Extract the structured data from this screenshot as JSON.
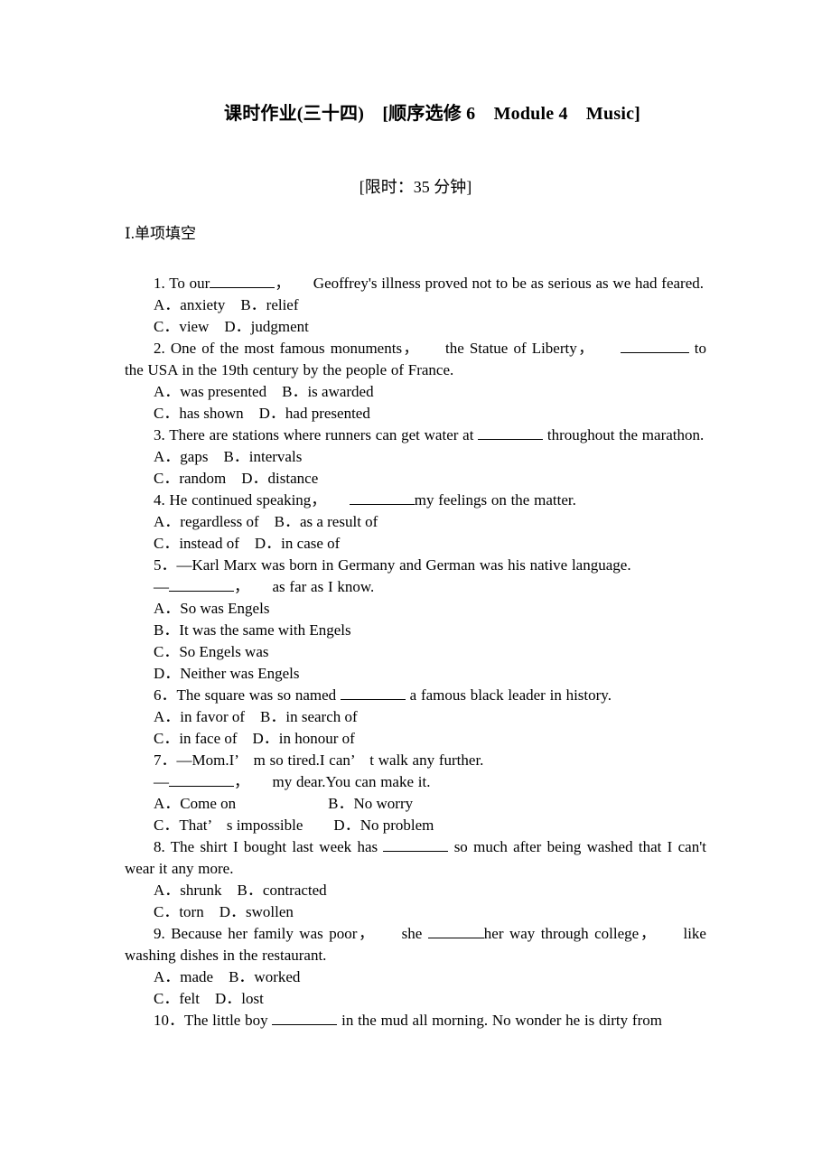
{
  "document": {
    "title": "课时作业(三十四)　[顺序选修 6　Module 4　Music]",
    "time_limit": "[限时：35 分钟]",
    "section_title": "Ⅰ.单项填空"
  },
  "questions": [
    {
      "number": "1",
      "stem_lines": [
        "1. To our",
        "，　　Geoffrey's illness proved not to be as serious as we had feared."
      ],
      "option_lines": [
        "A．anxiety　B．relief",
        "C．view　D．judgment"
      ]
    },
    {
      "number": "2",
      "stem_lines": [
        "2. One of the most famous monuments，　　the Statue of Liberty，　　",
        " to the USA in the 19th century by the people of France."
      ],
      "option_lines": [
        "A．was presented　B．is awarded",
        "C．has shown　D．had presented"
      ]
    },
    {
      "number": "3",
      "stem_lines": [
        "3. There are stations where runners can get water at ",
        " throughout the marathon."
      ],
      "option_lines": [
        "A．gaps　B．intervals",
        "C．random　D．distance"
      ]
    },
    {
      "number": "4",
      "stem_lines": [
        "4. He continued speaking，　　",
        "my feelings on the matter."
      ],
      "option_lines": [
        "A．regardless of　B．as a result of",
        "C．instead of　D．in case of"
      ]
    },
    {
      "number": "5",
      "stem_lines": [
        "5．—Karl Marx was born in Germany and German was his native language.",
        "—",
        "，　　as far as I know."
      ],
      "option_lines": [
        "A．So was Engels",
        "B．It was the same with Engels",
        "C．So Engels was",
        "D．Neither was Engels"
      ]
    },
    {
      "number": "6",
      "stem_lines": [
        "6．The square was so named ",
        " a famous black leader in history."
      ],
      "option_lines": [
        "A．in favor of　B．in search of",
        "C．in face of　D．in honour of"
      ]
    },
    {
      "number": "7",
      "stem_lines": [
        "7．—Mom.I’　m so tired.I can’　t walk any further.",
        "—",
        "，　　my dear.You can make it."
      ],
      "option_lines": [
        "A．Come on　　　　　　B．No worry",
        "C．That’　s impossible　　D．No problem"
      ]
    },
    {
      "number": "8",
      "stem_lines": [
        "8. The shirt I bought last week has ",
        " so much after being washed that I can't wear it any more."
      ],
      "option_lines": [
        "A．shrunk　B．contracted",
        "C．torn　D．swollen"
      ]
    },
    {
      "number": "9",
      "stem_lines": [
        "9. Because her family was poor，　　she ",
        "her way through college，　　like washing dishes in the restaurant."
      ],
      "option_lines": [
        "A．made　B．worked",
        "C．felt　D．lost"
      ]
    },
    {
      "number": "10",
      "stem_lines": [
        "10．The little boy ",
        " in the mud all morning. No wonder he is dirty from"
      ],
      "option_lines": []
    }
  ]
}
